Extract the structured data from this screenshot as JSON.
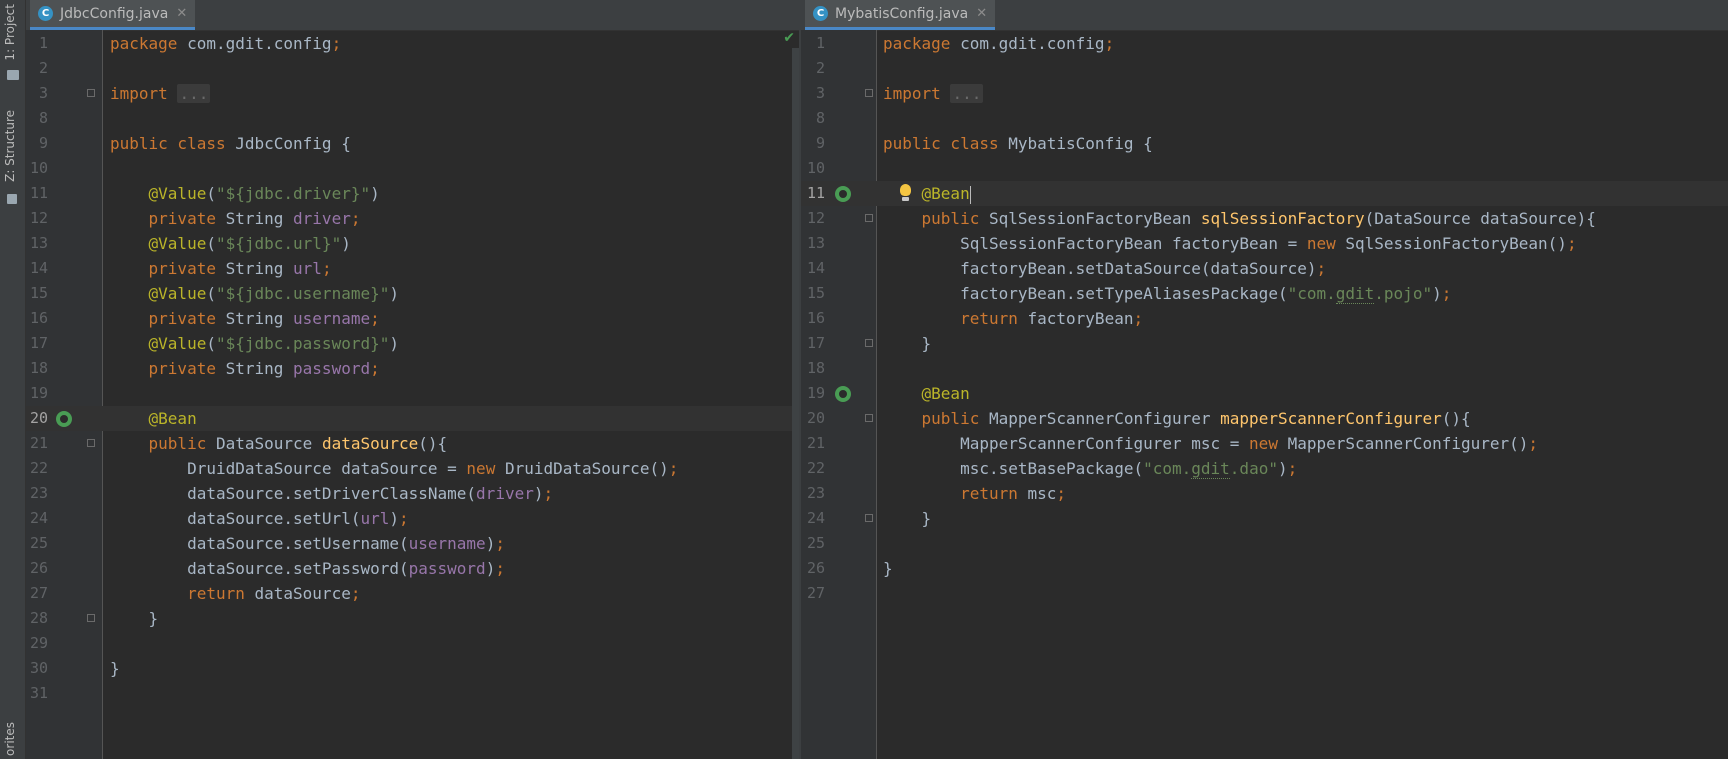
{
  "toolwindows": {
    "project_label": "1: Project",
    "structure_label": "Z: Structure",
    "favorites_label": "orites"
  },
  "left_editor": {
    "tab": {
      "icon_letter": "C",
      "title": "JdbcConfig.java",
      "close": "✕"
    },
    "status_check": "✔",
    "current_line": 20,
    "lines": [
      {
        "n": "1",
        "code": [
          [
            "kw",
            "package "
          ],
          [
            "p",
            "com.gdit.config"
          ],
          [
            "kw",
            ";"
          ]
        ]
      },
      {
        "n": "2",
        "code": []
      },
      {
        "n": "3",
        "code": [
          [
            "kw",
            "import "
          ],
          [
            "fold",
            "..."
          ]
        ],
        "fold": true
      },
      {
        "n": "8",
        "code": []
      },
      {
        "n": "9",
        "code": [
          [
            "kw",
            "public class "
          ],
          [
            "p",
            "JdbcConfig {"
          ]
        ]
      },
      {
        "n": "10",
        "code": []
      },
      {
        "n": "11",
        "code": [
          [
            "p",
            "    "
          ],
          [
            "ann",
            "@Value"
          ],
          [
            "p",
            "("
          ],
          [
            "str",
            "\"${jdbc.driver}\""
          ],
          [
            "p",
            ")"
          ]
        ]
      },
      {
        "n": "12",
        "code": [
          [
            "p",
            "    "
          ],
          [
            "kw",
            "private "
          ],
          [
            "p",
            "String "
          ],
          [
            "fld",
            "driver"
          ],
          [
            "kw",
            ";"
          ]
        ]
      },
      {
        "n": "13",
        "code": [
          [
            "p",
            "    "
          ],
          [
            "ann",
            "@Value"
          ],
          [
            "p",
            "("
          ],
          [
            "str",
            "\"${jdbc.url}\""
          ],
          [
            "p",
            ")"
          ]
        ]
      },
      {
        "n": "14",
        "code": [
          [
            "p",
            "    "
          ],
          [
            "kw",
            "private "
          ],
          [
            "p",
            "String "
          ],
          [
            "fld",
            "url"
          ],
          [
            "kw",
            ";"
          ]
        ]
      },
      {
        "n": "15",
        "code": [
          [
            "p",
            "    "
          ],
          [
            "ann",
            "@Value"
          ],
          [
            "p",
            "("
          ],
          [
            "str",
            "\"${jdbc.username}\""
          ],
          [
            "p",
            ")"
          ]
        ]
      },
      {
        "n": "16",
        "code": [
          [
            "p",
            "    "
          ],
          [
            "kw",
            "private "
          ],
          [
            "p",
            "String "
          ],
          [
            "fld",
            "username"
          ],
          [
            "kw",
            ";"
          ]
        ]
      },
      {
        "n": "17",
        "code": [
          [
            "p",
            "    "
          ],
          [
            "ann",
            "@Value"
          ],
          [
            "p",
            "("
          ],
          [
            "str",
            "\"${jdbc.password}\""
          ],
          [
            "p",
            ")"
          ]
        ]
      },
      {
        "n": "18",
        "code": [
          [
            "p",
            "    "
          ],
          [
            "kw",
            "private "
          ],
          [
            "p",
            "String "
          ],
          [
            "fld",
            "password"
          ],
          [
            "kw",
            ";"
          ]
        ]
      },
      {
        "n": "19",
        "code": []
      },
      {
        "n": "20",
        "code": [
          [
            "p",
            "    "
          ],
          [
            "ann",
            "@Bean"
          ]
        ],
        "bean": true
      },
      {
        "n": "21",
        "code": [
          [
            "p",
            "    "
          ],
          [
            "kw",
            "public "
          ],
          [
            "p",
            "DataSource "
          ],
          [
            "mth",
            "dataSource"
          ],
          [
            "p",
            "(){"
          ]
        ],
        "fold": true
      },
      {
        "n": "22",
        "code": [
          [
            "p",
            "        DruidDataSource dataSource = "
          ],
          [
            "kw",
            "new "
          ],
          [
            "p",
            "DruidDataSource()"
          ],
          [
            "kw",
            ";"
          ]
        ]
      },
      {
        "n": "23",
        "code": [
          [
            "p",
            "        dataSource.setDriverClassName("
          ],
          [
            "fld",
            "driver"
          ],
          [
            "p",
            ")"
          ],
          [
            "kw",
            ";"
          ]
        ]
      },
      {
        "n": "24",
        "code": [
          [
            "p",
            "        dataSource.setUrl("
          ],
          [
            "fld",
            "url"
          ],
          [
            "p",
            ")"
          ],
          [
            "kw",
            ";"
          ]
        ]
      },
      {
        "n": "25",
        "code": [
          [
            "p",
            "        dataSource.setUsername("
          ],
          [
            "fld",
            "username"
          ],
          [
            "p",
            ")"
          ],
          [
            "kw",
            ";"
          ]
        ]
      },
      {
        "n": "26",
        "code": [
          [
            "p",
            "        dataSource.setPassword("
          ],
          [
            "fld",
            "password"
          ],
          [
            "p",
            ")"
          ],
          [
            "kw",
            ";"
          ]
        ]
      },
      {
        "n": "27",
        "code": [
          [
            "p",
            "        "
          ],
          [
            "kw",
            "return "
          ],
          [
            "p",
            "dataSource"
          ],
          [
            "kw",
            ";"
          ]
        ]
      },
      {
        "n": "28",
        "code": [
          [
            "p",
            "    }"
          ]
        ],
        "fold": true
      },
      {
        "n": "29",
        "code": []
      },
      {
        "n": "30",
        "code": [
          [
            "p",
            "}"
          ]
        ]
      },
      {
        "n": "31",
        "code": []
      }
    ]
  },
  "right_editor": {
    "tab": {
      "icon_letter": "C",
      "title": "MybatisConfig.java",
      "close": "✕"
    },
    "current_line": 11,
    "lines": [
      {
        "n": "1",
        "code": [
          [
            "kw",
            "package "
          ],
          [
            "p",
            "com.gdit.config"
          ],
          [
            "kw",
            ";"
          ]
        ]
      },
      {
        "n": "2",
        "code": []
      },
      {
        "n": "3",
        "code": [
          [
            "kw",
            "import "
          ],
          [
            "fold",
            "..."
          ]
        ],
        "fold": true
      },
      {
        "n": "8",
        "code": []
      },
      {
        "n": "9",
        "code": [
          [
            "kw",
            "public class "
          ],
          [
            "p",
            "MybatisConfig {"
          ]
        ]
      },
      {
        "n": "10",
        "code": []
      },
      {
        "n": "11",
        "code": [
          [
            "p",
            "    "
          ],
          [
            "ann",
            "@Bean"
          ],
          [
            "caret",
            ""
          ]
        ],
        "bean": true,
        "bulb": true
      },
      {
        "n": "12",
        "code": [
          [
            "p",
            "    "
          ],
          [
            "kw",
            "public "
          ],
          [
            "p",
            "SqlSessionFactoryBean "
          ],
          [
            "mth",
            "sqlSessionFactory"
          ],
          [
            "p",
            "(DataSource dataSource){"
          ]
        ],
        "fold": true
      },
      {
        "n": "13",
        "code": [
          [
            "p",
            "        SqlSessionFactoryBean factoryBean = "
          ],
          [
            "kw",
            "new "
          ],
          [
            "p",
            "SqlSessionFactoryBean()"
          ],
          [
            "kw",
            ";"
          ]
        ]
      },
      {
        "n": "14",
        "code": [
          [
            "p",
            "        factoryBean.setDataSource(dataSource)"
          ],
          [
            "kw",
            ";"
          ]
        ]
      },
      {
        "n": "15",
        "code": [
          [
            "p",
            "        factoryBean.setTypeAliasesPackage("
          ],
          [
            "str",
            "\"com."
          ],
          [
            "sq",
            "gdit"
          ],
          [
            "str",
            ".pojo\""
          ],
          [
            "p",
            ")"
          ],
          [
            "kw",
            ";"
          ]
        ]
      },
      {
        "n": "16",
        "code": [
          [
            "p",
            "        "
          ],
          [
            "kw",
            "return "
          ],
          [
            "p",
            "factoryBean"
          ],
          [
            "kw",
            ";"
          ]
        ]
      },
      {
        "n": "17",
        "code": [
          [
            "p",
            "    }"
          ]
        ],
        "fold": true
      },
      {
        "n": "18",
        "code": []
      },
      {
        "n": "19",
        "code": [
          [
            "p",
            "    "
          ],
          [
            "ann",
            "@Bean"
          ]
        ],
        "bean": true
      },
      {
        "n": "20",
        "code": [
          [
            "p",
            "    "
          ],
          [
            "kw",
            "public "
          ],
          [
            "p",
            "MapperScannerConfigurer "
          ],
          [
            "mth",
            "mapperScannerConfigurer"
          ],
          [
            "p",
            "(){"
          ]
        ],
        "fold": true
      },
      {
        "n": "21",
        "code": [
          [
            "p",
            "        MapperScannerConfigurer msc = "
          ],
          [
            "kw",
            "new "
          ],
          [
            "p",
            "MapperScannerConfigurer()"
          ],
          [
            "kw",
            ";"
          ]
        ]
      },
      {
        "n": "22",
        "code": [
          [
            "p",
            "        msc.setBasePackage("
          ],
          [
            "str",
            "\"com."
          ],
          [
            "sq",
            "gdit"
          ],
          [
            "str",
            ".dao\""
          ],
          [
            "p",
            ")"
          ],
          [
            "kw",
            ";"
          ]
        ]
      },
      {
        "n": "23",
        "code": [
          [
            "p",
            "        "
          ],
          [
            "kw",
            "return "
          ],
          [
            "p",
            "msc"
          ],
          [
            "kw",
            ";"
          ]
        ]
      },
      {
        "n": "24",
        "code": [
          [
            "p",
            "    }"
          ]
        ],
        "fold": true
      },
      {
        "n": "25",
        "code": []
      },
      {
        "n": "26",
        "code": [
          [
            "p",
            "}"
          ]
        ]
      },
      {
        "n": "27",
        "code": []
      }
    ]
  }
}
